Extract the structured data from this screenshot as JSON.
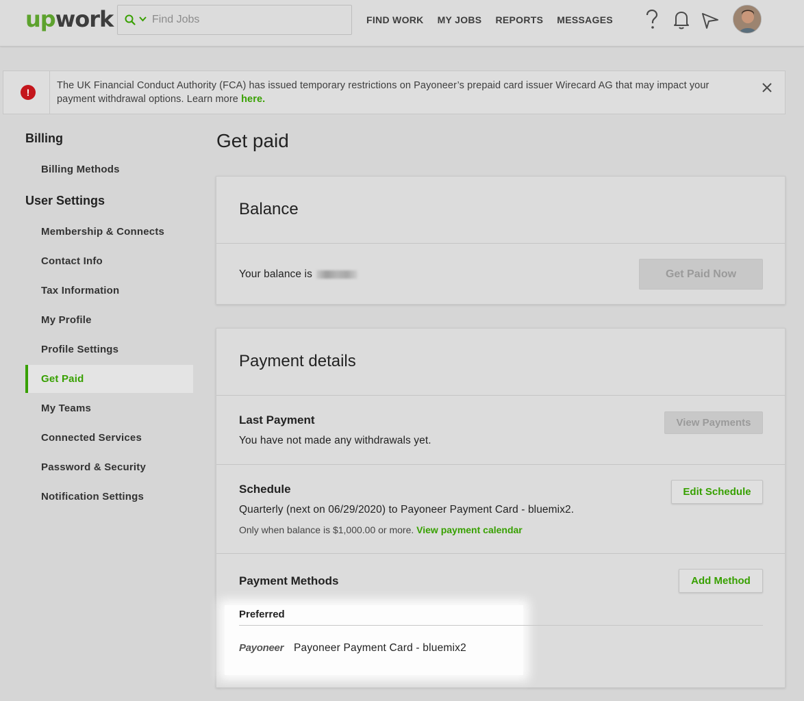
{
  "header": {
    "logo_up": "up",
    "logo_work": "work",
    "search_placeholder": "Find Jobs",
    "nav": [
      "FIND WORK",
      "MY JOBS",
      "REPORTS",
      "MESSAGES"
    ],
    "icons": [
      "help-icon",
      "bell-icon",
      "send-icon",
      "avatar"
    ]
  },
  "alert": {
    "text": "The UK Financial Conduct Authority (FCA) has issued temporary restrictions on Payoneer’s prepaid card issuer Wirecard AG that may impact your payment withdrawal options. Learn more ",
    "link": "here."
  },
  "sidebar": {
    "billing_heading": "Billing",
    "billing_items": [
      "Billing Methods"
    ],
    "user_heading": "User Settings",
    "user_items": [
      "Membership & Connects",
      "Contact Info",
      "Tax Information",
      "My Profile",
      "Profile Settings",
      "Get Paid",
      "My Teams",
      "Connected Services",
      "Password & Security",
      "Notification Settings"
    ],
    "active": "Get Paid"
  },
  "main": {
    "page_title": "Get paid",
    "balance": {
      "title": "Balance",
      "text": "Your balance is",
      "button": "Get Paid Now"
    },
    "payment": {
      "title": "Payment details",
      "last_title": "Last Payment",
      "last_text": "You have not made any withdrawals yet.",
      "view_button": "View Payments",
      "schedule_title": "Schedule",
      "schedule_text": "Quarterly (next on 06/29/2020) to Payoneer Payment Card - bluemix2.",
      "schedule_small": "Only when balance is $1,000.00 or more.",
      "schedule_link": "View payment calendar",
      "edit_button": "Edit Schedule",
      "methods_title": "Payment Methods",
      "add_button": "Add Method",
      "preferred_label": "Preferred",
      "method_logo": "Payoneer",
      "method_name": "Payoneer Payment Card - bluemix2"
    }
  },
  "colors": {
    "accent": "#37a000",
    "brand_green": "#5da22e",
    "error": "#c4161c"
  }
}
